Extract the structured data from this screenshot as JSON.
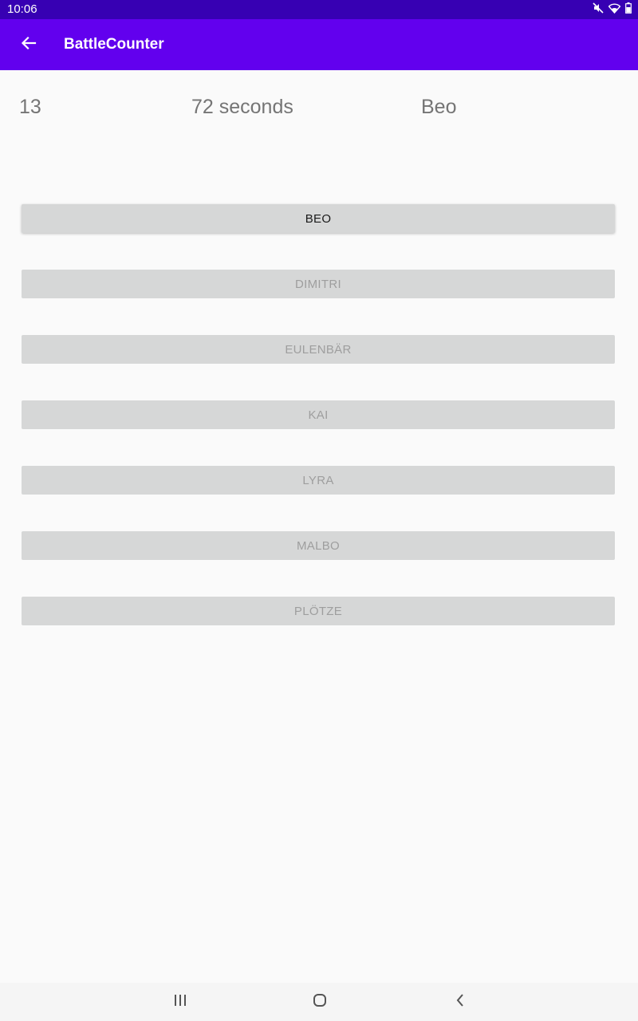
{
  "status_bar": {
    "time": "10:06",
    "icons": [
      "mute-icon",
      "wifi-icon",
      "battery-icon"
    ]
  },
  "app_bar": {
    "title": "BattleCounter",
    "back_icon": "arrow-left-icon",
    "background_color": "#6200ee"
  },
  "info": {
    "count": "13",
    "duration": "72 seconds",
    "current_player": "Beo"
  },
  "players": [
    {
      "label": "BEO",
      "active": true
    },
    {
      "label": "DIMITRI",
      "active": false
    },
    {
      "label": "EULENBÄR",
      "active": false
    },
    {
      "label": "KAI",
      "active": false
    },
    {
      "label": "LYRA",
      "active": false
    },
    {
      "label": "MALBO",
      "active": false
    },
    {
      "label": "PLÖTZE",
      "active": false
    }
  ],
  "nav_bar": {
    "icons": [
      "recent-apps-icon",
      "home-icon",
      "back-nav-icon"
    ]
  }
}
